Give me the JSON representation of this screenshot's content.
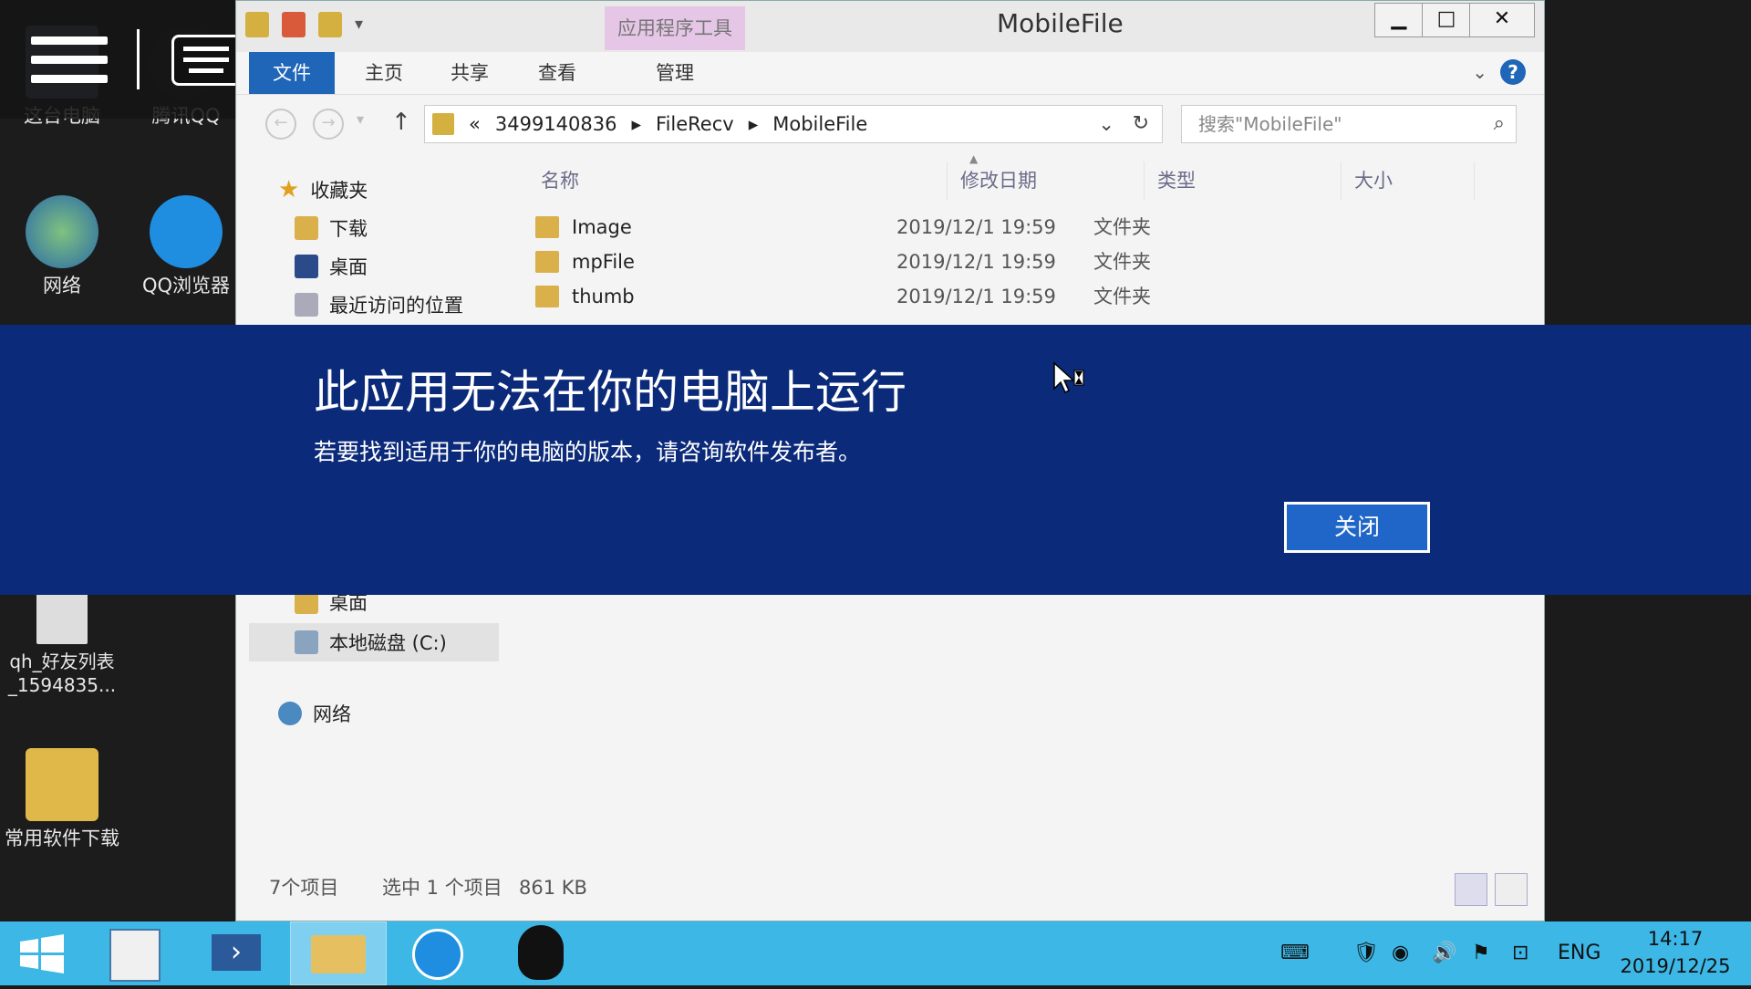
{
  "desktop": {
    "icons": [
      {
        "label": "这台电脑"
      },
      {
        "label": "腾讯QQ"
      },
      {
        "label": "网络"
      },
      {
        "label": "QQ浏览器"
      },
      {
        "label": "qh_好友列表_1594835..."
      },
      {
        "label": "常用软件下载"
      }
    ]
  },
  "window": {
    "title": "MobileFile",
    "tool_tab": "应用程序工具",
    "ribbon_tabs": [
      "文件",
      "主页",
      "共享",
      "查看",
      "管理"
    ],
    "breadcrumb": {
      "overflow": "«",
      "parts": [
        "3499140836",
        "FileRecv",
        "MobileFile"
      ]
    },
    "search_placeholder": "搜索\"MobileFile\"",
    "nav": {
      "favorites": "收藏夹",
      "downloads": "下载",
      "desktop": "桌面",
      "recent": "最近访问的位置",
      "desktop2": "桌面",
      "local_disk": "本地磁盘 (C:)",
      "network": "网络"
    },
    "columns": [
      "名称",
      "修改日期",
      "类型",
      "大小"
    ],
    "files": [
      {
        "name": "Image",
        "date": "2019/12/1 19:59",
        "type": "文件夹"
      },
      {
        "name": "mpFile",
        "date": "2019/12/1 19:59",
        "type": "文件夹"
      },
      {
        "name": "thumb",
        "date": "2019/12/1 19:59",
        "type": "文件夹"
      }
    ],
    "status": {
      "count": "7个项目",
      "selected": "选中 1 个项目",
      "size": "861 KB"
    }
  },
  "error": {
    "title": "此应用无法在你的电脑上运行",
    "message": "若要找到适用于你的电脑的版本，请咨询软件发布者。",
    "close_label": "关闭"
  },
  "taskbar": {
    "tray_lang": "ENG",
    "time": "14:17",
    "date": "2019/12/25"
  },
  "colors": {
    "banner": "#0b2a7a",
    "taskbar": "#3cb7e6",
    "accent": "#1f66b8"
  }
}
